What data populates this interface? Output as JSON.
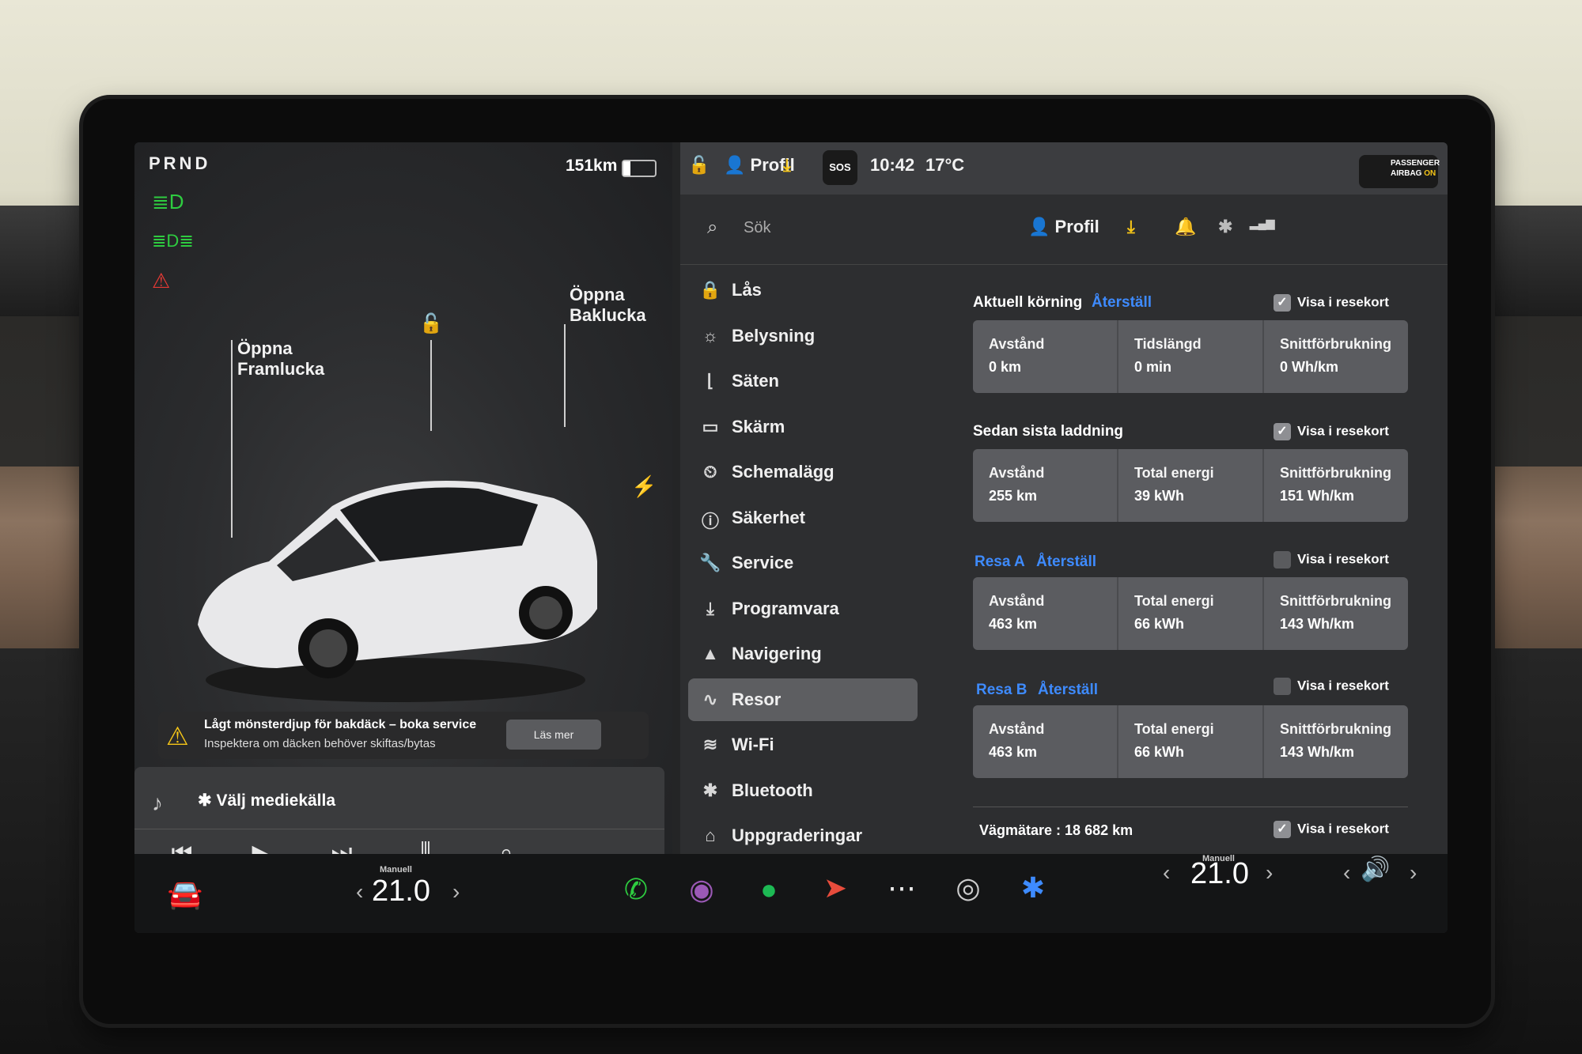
{
  "drive": {
    "gears": "PRND",
    "range": "151km",
    "battery_level": 0.22
  },
  "car": {
    "front_trunk_label": [
      "Öppna",
      "Framlucka"
    ],
    "rear_trunk_label": [
      "Öppna",
      "Baklucka"
    ]
  },
  "alert": {
    "title": "Lågt mönsterdjup för bakdäck – boka service",
    "subtitle": "Inspektera om däcken behöver skiftas/bytas",
    "button": "Läs mer"
  },
  "media": {
    "source": "Välj mediekälla"
  },
  "status": {
    "profile": "Profil",
    "sos": "SOS",
    "time": "10:42",
    "temp": "17°C",
    "airbag_line1": "PASSENGER",
    "airbag_line2": "AIRBAG",
    "airbag_state": "ON"
  },
  "search": {
    "placeholder": "Sök",
    "profile": "Profil"
  },
  "menu": [
    {
      "label": "Lås",
      "icon": "lock-icon"
    },
    {
      "label": "Belysning",
      "icon": "sun-icon"
    },
    {
      "label": "Säten",
      "icon": "seat-icon"
    },
    {
      "label": "Skärm",
      "icon": "display-icon"
    },
    {
      "label": "Schemalägg",
      "icon": "clock-icon"
    },
    {
      "label": "Säkerhet",
      "icon": "info-circle-icon"
    },
    {
      "label": "Service",
      "icon": "wrench-icon"
    },
    {
      "label": "Programvara",
      "icon": "download-icon"
    },
    {
      "label": "Navigering",
      "icon": "navigation-icon"
    },
    {
      "label": "Resor",
      "icon": "trips-icon",
      "active": true
    },
    {
      "label": "Wi-Fi",
      "icon": "wifi-icon"
    },
    {
      "label": "Bluetooth",
      "icon": "bluetooth-icon"
    },
    {
      "label": "Uppgraderingar",
      "icon": "bag-icon"
    }
  ],
  "trips": {
    "current": {
      "title": "Aktuell körning",
      "reset": "Återställ",
      "show": "Visa i resekort",
      "checked": true,
      "cells": [
        {
          "k": "Avstånd",
          "v": "0 km"
        },
        {
          "k": "Tidslängd",
          "v": "0 min"
        },
        {
          "k": "Snittförbrukning",
          "v": "0 Wh/km"
        }
      ]
    },
    "since_charge": {
      "title": "Sedan sista laddning",
      "show": "Visa i resekort",
      "checked": true,
      "cells": [
        {
          "k": "Avstånd",
          "v": "255 km"
        },
        {
          "k": "Total energi",
          "v": "39 kWh"
        },
        {
          "k": "Snittförbrukning",
          "v": "151 Wh/km"
        }
      ]
    },
    "trip_a": {
      "title": "Resa A",
      "reset": "Återställ",
      "show": "Visa i resekort",
      "checked": false,
      "cells": [
        {
          "k": "Avstånd",
          "v": "463 km"
        },
        {
          "k": "Total energi",
          "v": "66 kWh"
        },
        {
          "k": "Snittförbrukning",
          "v": "143 Wh/km"
        }
      ]
    },
    "trip_b": {
      "title": "Resa B",
      "reset": "Återställ",
      "show": "Visa i resekort",
      "checked": false,
      "cells": [
        {
          "k": "Avstånd",
          "v": "463 km"
        },
        {
          "k": "Total energi",
          "v": "66 kWh"
        },
        {
          "k": "Snittförbrukning",
          "v": "143 Wh/km"
        }
      ]
    },
    "odometer": "Vägmätare : 18 682 km",
    "odometer_show": "Visa i resekort"
  },
  "climate": {
    "left_mode": "Manuell",
    "left_temp": "21.0",
    "right_mode": "Manuell",
    "right_temp": "21.0"
  },
  "colors": {
    "accent": "#3e8bff",
    "green": "#2ecc40",
    "red": "#e53935",
    "warning": "#f5c518"
  }
}
